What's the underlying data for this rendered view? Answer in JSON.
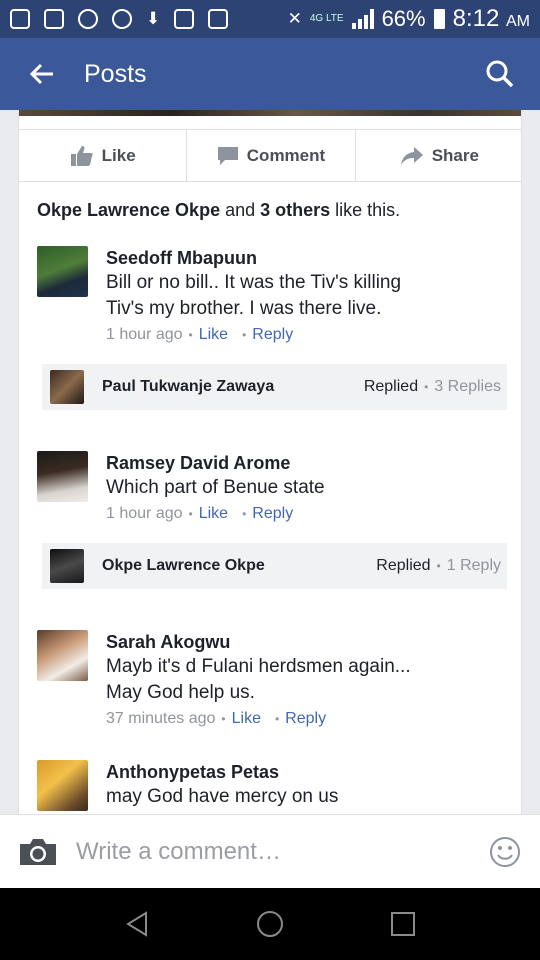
{
  "status_bar": {
    "network": "4G LTE",
    "battery": "66%",
    "time": "8:12",
    "ampm": "AM"
  },
  "app_bar": {
    "title": "Posts",
    "back_icon": "arrow-left-icon",
    "search_icon": "search-icon",
    "color": "#3b5998"
  },
  "actions": [
    {
      "label": "Like",
      "icon": "thumbs-up-icon"
    },
    {
      "label": "Comment",
      "icon": "speech-bubble-icon"
    },
    {
      "label": "Share",
      "icon": "share-arrow-icon"
    }
  ],
  "likes_summary": {
    "name": "Okpe Lawrence Okpe",
    "and": " and ",
    "others": "3 others",
    "suffix": " like this."
  },
  "comments": [
    {
      "name": "Seedoff Mbapuun",
      "text_lines": [
        "Bill or no bill.. It was the Tiv's killing",
        "Tiv's my brother. I was there live."
      ],
      "time": "1 hour ago",
      "like": "Like",
      "reply": "Reply",
      "replies": {
        "name": "Paul Tukwanje Zawaya",
        "replied": "Replied",
        "count": "3 Replies"
      }
    },
    {
      "name": "Ramsey David Arome",
      "text_lines": [
        "Which part of Benue state"
      ],
      "time": "1 hour ago",
      "like": "Like",
      "reply": "Reply",
      "replies": {
        "name": "Okpe Lawrence Okpe",
        "replied": "Replied",
        "count": "1 Reply"
      }
    },
    {
      "name": "Sarah Akogwu",
      "text_lines": [
        "Mayb it's d Fulani herdsmen again...",
        "May God help us."
      ],
      "time": "37 minutes ago",
      "like": "Like",
      "reply": "Reply"
    },
    {
      "name": "Anthonypetas Petas",
      "text_lines": [
        "may God have mercy on us"
      ]
    }
  ],
  "composer": {
    "placeholder": "Write a comment…",
    "camera_icon": "camera-icon",
    "emoji_icon": "smiley-icon"
  },
  "nav_bar": {
    "back": "triangle-back-icon",
    "home": "circle-home-icon",
    "recents": "square-recents-icon"
  }
}
